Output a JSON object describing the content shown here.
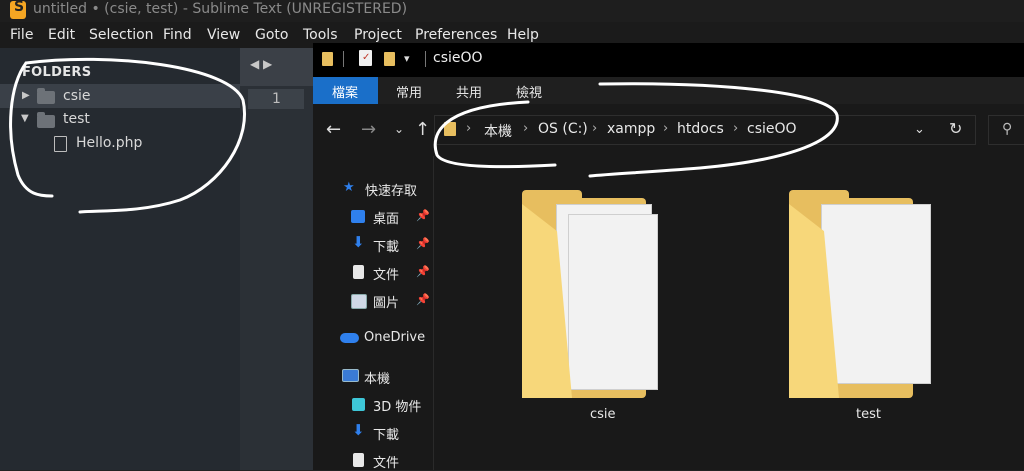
{
  "sublime": {
    "title": "untitled • (csie, test) - Sublime Text (UNREGISTERED)",
    "menu": [
      "File",
      "Edit",
      "Selection",
      "Find",
      "View",
      "Goto",
      "Tools",
      "Project",
      "Preferences",
      "Help"
    ],
    "sidebar_header": "FOLDERS",
    "tree": [
      {
        "label": "csie"
      },
      {
        "label": "test"
      },
      {
        "label": "Hello.php"
      }
    ],
    "gutter_tabs": "◀ ▶",
    "line_number": "1"
  },
  "explorer": {
    "title": "csieOO",
    "ribbon_tabs": [
      "檔案",
      "常用",
      "共用",
      "檢視"
    ],
    "breadcrumb": [
      "本機",
      "OS (C:)",
      "xampp",
      "htdocs",
      "csieOO"
    ],
    "nav_pane": {
      "quick_access": "快速存取",
      "desktop": "桌面",
      "downloads": "下載",
      "documents": "文件",
      "pictures": "圖片",
      "onedrive": "OneDrive",
      "this_pc": "本機",
      "objects3d": "3D 物件",
      "downloads2": "下載",
      "documents2": "文件"
    },
    "folders": [
      "csie",
      "test"
    ]
  },
  "colors": {
    "ribbon_active": "#1a6fc9",
    "folder_yellow": "#e7be5f",
    "annotation": "#ffffff"
  }
}
